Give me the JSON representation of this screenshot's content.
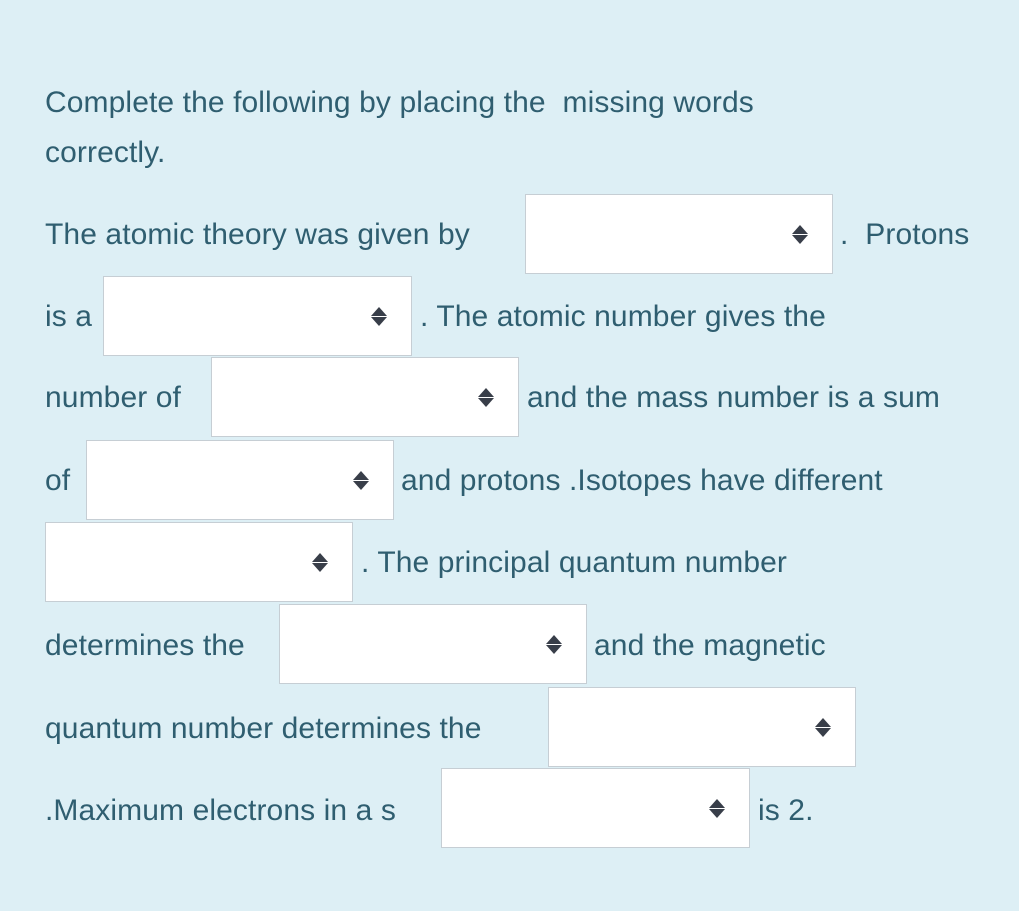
{
  "page": {
    "background_color": "#ddeff5",
    "text_color": "#2f5e70",
    "select_background": "#ffffff",
    "select_border_color": "#c6ced4",
    "select_arrow_color": "#383e49"
  },
  "prompt": {
    "line1": "Complete the following by placing the  missing words",
    "line2": "correctly."
  },
  "sentence": {
    "seg1": "The atomic theory was given by",
    "seg2": ".  Protons",
    "seg3": "is a",
    "seg4": ". The atomic number gives the",
    "seg5": "number of",
    "seg6": "and the mass number is a sum",
    "seg7": "of",
    "seg8": "and protons .Isotopes have different",
    "seg9": ". The principal quantum number",
    "seg10": "determines the",
    "seg11": "and the magnetic",
    "seg12": "quantum number determines the",
    "seg13": ".Maximum electrons in a s",
    "seg14": "is 2."
  },
  "dropdowns": [
    {
      "id": "blank-1",
      "value": "",
      "placeholder": "",
      "icon": "updown-arrows-icon"
    },
    {
      "id": "blank-2",
      "value": "",
      "placeholder": "",
      "icon": "updown-arrows-icon"
    },
    {
      "id": "blank-3",
      "value": "",
      "placeholder": "",
      "icon": "updown-arrows-icon"
    },
    {
      "id": "blank-4",
      "value": "",
      "placeholder": "",
      "icon": "updown-arrows-icon"
    },
    {
      "id": "blank-5",
      "value": "",
      "placeholder": "",
      "icon": "updown-arrows-icon"
    },
    {
      "id": "blank-6",
      "value": "",
      "placeholder": "",
      "icon": "updown-arrows-icon"
    },
    {
      "id": "blank-7",
      "value": "",
      "placeholder": "",
      "icon": "updown-arrows-icon"
    },
    {
      "id": "blank-8",
      "value": "",
      "placeholder": "",
      "icon": "updown-arrows-icon"
    }
  ]
}
